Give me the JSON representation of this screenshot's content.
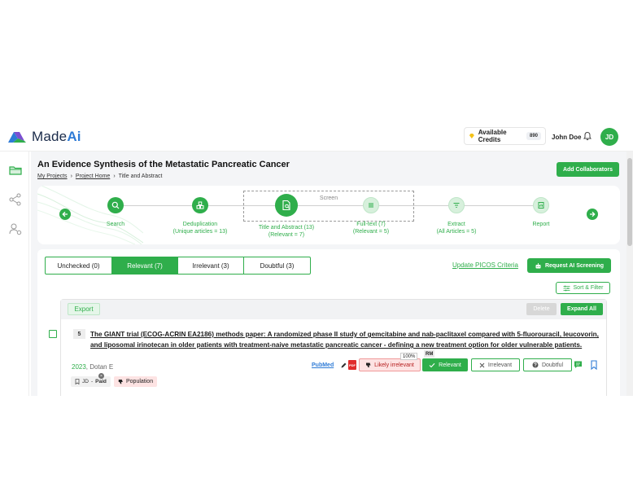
{
  "app": {
    "logo_text_a": "Made",
    "logo_text_b": "Ai"
  },
  "header": {
    "credits_label": "Available Credits",
    "credits_count": "890",
    "user_name": "John Doe",
    "avatar_initials": "JD"
  },
  "page": {
    "title": "An Evidence Synthesis of the Metastatic Pancreatic Cancer",
    "breadcrumb": [
      "My Projects",
      "Project Home",
      "Title and Abstract"
    ],
    "add_collaborators": "Add Collaborators"
  },
  "stepper": {
    "screen_label": "Screen",
    "steps": [
      {
        "name": "Search",
        "sub": ""
      },
      {
        "name": "Deduplication",
        "sub": "(Unique articles = 13)"
      },
      {
        "name": "Title and Abstract (13)",
        "sub": "(Relevant = 7)"
      },
      {
        "name": "Full-text (7)",
        "sub": "(Relevant = 5)"
      },
      {
        "name": "Extract",
        "sub": "(All Articles = 5)"
      },
      {
        "name": "Report",
        "sub": ""
      }
    ]
  },
  "tabs": [
    {
      "label": "Unchecked (0)",
      "active": false
    },
    {
      "label": "Relevant (7)",
      "active": true
    },
    {
      "label": "Irrelevant (3)",
      "active": false
    },
    {
      "label": "Doubtful (3)",
      "active": false
    }
  ],
  "actions": {
    "update_picos": "Update PICOS Criteria",
    "request_ai": "Request AI Screening",
    "sort_filter": "Sort & Filter",
    "export": "Export",
    "delete": "Delete",
    "expand_all": "Expand All"
  },
  "article": {
    "number": "5",
    "title": "The GIANT trial (ECOG-ACRIN EA2186) methods paper: A randomized phase II study of gemcitabine and nab-paclitaxel compared with 5-fluorouracil, leucovorin, and liposomal irinotecan in older patients with treatment-naive metastatic pancreatic cancer - defining a new treatment option for older vulnerable patients.",
    "year": "2023",
    "author": "Dotan E",
    "source": "PubMed",
    "pdf_label": "PDF",
    "ai_prediction": "Likely irrelevant",
    "ai_confidence": "100%",
    "rm_badge": "RM",
    "btn_relevant": "Relevant",
    "btn_irrelevant": "Irrelevant",
    "btn_doubtful": "Doubtful",
    "tags": {
      "user_tag_initials": "JD",
      "user_tag_sep": "-",
      "user_tag_label": "Paid",
      "criteria_tag": "Population"
    }
  },
  "colors": {
    "accent": "#2fae4b",
    "danger": "#e02b2b",
    "link": "#2e7bd6"
  }
}
